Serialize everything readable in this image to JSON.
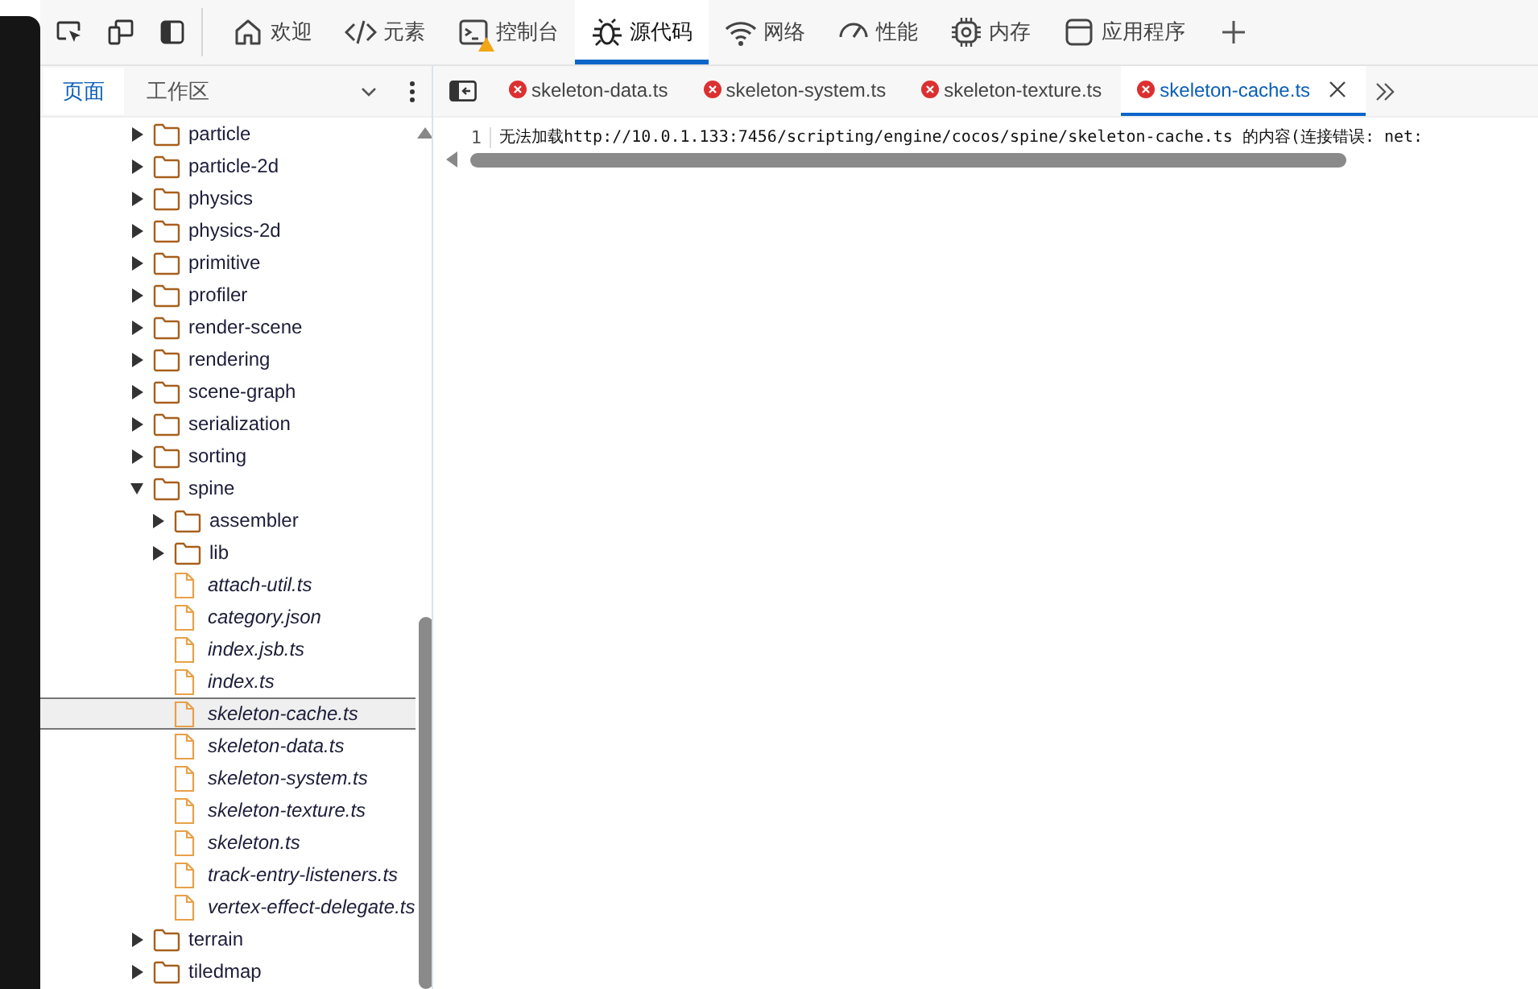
{
  "toolbar": {
    "tools": [
      {
        "kind": "inspect"
      },
      {
        "kind": "device"
      },
      {
        "kind": "dock"
      }
    ],
    "tabs": [
      {
        "kind": "home",
        "label": "欢迎",
        "selected": false,
        "warning": false
      },
      {
        "kind": "code",
        "label": "元素",
        "selected": false,
        "warning": false
      },
      {
        "kind": "console",
        "label": "控制台",
        "selected": false,
        "warning": true
      },
      {
        "kind": "bug",
        "label": "源代码",
        "selected": true,
        "warning": false
      },
      {
        "kind": "wifi",
        "label": "网络",
        "selected": false,
        "warning": false
      },
      {
        "kind": "gauge",
        "label": "性能",
        "selected": false,
        "warning": false
      },
      {
        "kind": "chip",
        "label": "内存",
        "selected": false,
        "warning": false
      },
      {
        "kind": "window",
        "label": "应用程序",
        "selected": false,
        "warning": false
      }
    ]
  },
  "sidebar": {
    "tabs": [
      {
        "label": "页面",
        "selected": true
      },
      {
        "label": "工作区",
        "selected": false
      }
    ],
    "tree": [
      {
        "kind": "folder",
        "name": "particle",
        "expanded": false,
        "selected": false
      },
      {
        "kind": "folder",
        "name": "particle-2d",
        "expanded": false,
        "selected": false
      },
      {
        "kind": "folder",
        "name": "physics",
        "expanded": false,
        "selected": false
      },
      {
        "kind": "folder",
        "name": "physics-2d",
        "expanded": false,
        "selected": false
      },
      {
        "kind": "folder",
        "name": "primitive",
        "expanded": false,
        "selected": false
      },
      {
        "kind": "folder",
        "name": "profiler",
        "expanded": false,
        "selected": false
      },
      {
        "kind": "folder",
        "name": "render-scene",
        "expanded": false,
        "selected": false
      },
      {
        "kind": "folder",
        "name": "rendering",
        "expanded": false,
        "selected": false
      },
      {
        "kind": "folder",
        "name": "scene-graph",
        "expanded": false,
        "selected": false
      },
      {
        "kind": "folder",
        "name": "serialization",
        "expanded": false,
        "selected": false
      },
      {
        "kind": "folder",
        "name": "sorting",
        "expanded": false,
        "selected": false
      },
      {
        "kind": "folder",
        "name": "spine",
        "expanded": true,
        "selected": false,
        "children": [
          {
            "kind": "folder",
            "name": "assembler",
            "expanded": false,
            "selected": false
          },
          {
            "kind": "folder",
            "name": "lib",
            "expanded": false,
            "selected": false
          },
          {
            "kind": "file",
            "name": "attach-util.ts",
            "selected": false
          },
          {
            "kind": "file",
            "name": "category.json",
            "selected": false
          },
          {
            "kind": "file",
            "name": "index.jsb.ts",
            "selected": false
          },
          {
            "kind": "file",
            "name": "index.ts",
            "selected": false
          },
          {
            "kind": "file",
            "name": "skeleton-cache.ts",
            "selected": true
          },
          {
            "kind": "file",
            "name": "skeleton-data.ts",
            "selected": false
          },
          {
            "kind": "file",
            "name": "skeleton-system.ts",
            "selected": false
          },
          {
            "kind": "file",
            "name": "skeleton-texture.ts",
            "selected": false
          },
          {
            "kind": "file",
            "name": "skeleton.ts",
            "selected": false
          },
          {
            "kind": "file",
            "name": "track-entry-listeners.ts",
            "selected": false
          },
          {
            "kind": "file",
            "name": "vertex-effect-delegate.ts",
            "selected": false
          }
        ]
      },
      {
        "kind": "folder",
        "name": "terrain",
        "expanded": false,
        "selected": false
      },
      {
        "kind": "folder",
        "name": "tiledmap",
        "expanded": false,
        "selected": false
      }
    ]
  },
  "editor": {
    "tabs": [
      {
        "label": "skeleton-data.ts",
        "error": true,
        "selected": false
      },
      {
        "label": "skeleton-system.ts",
        "error": true,
        "selected": false
      },
      {
        "label": "skeleton-texture.ts",
        "error": true,
        "selected": false
      },
      {
        "label": "skeleton-cache.ts",
        "error": true,
        "selected": true
      }
    ],
    "lines": [
      {
        "number": "1",
        "text": "无法加载http://10.0.1.133:7456/scripting/engine/cocos/spine/skeleton-cache.ts 的内容(连接错误: net:"
      }
    ]
  }
}
